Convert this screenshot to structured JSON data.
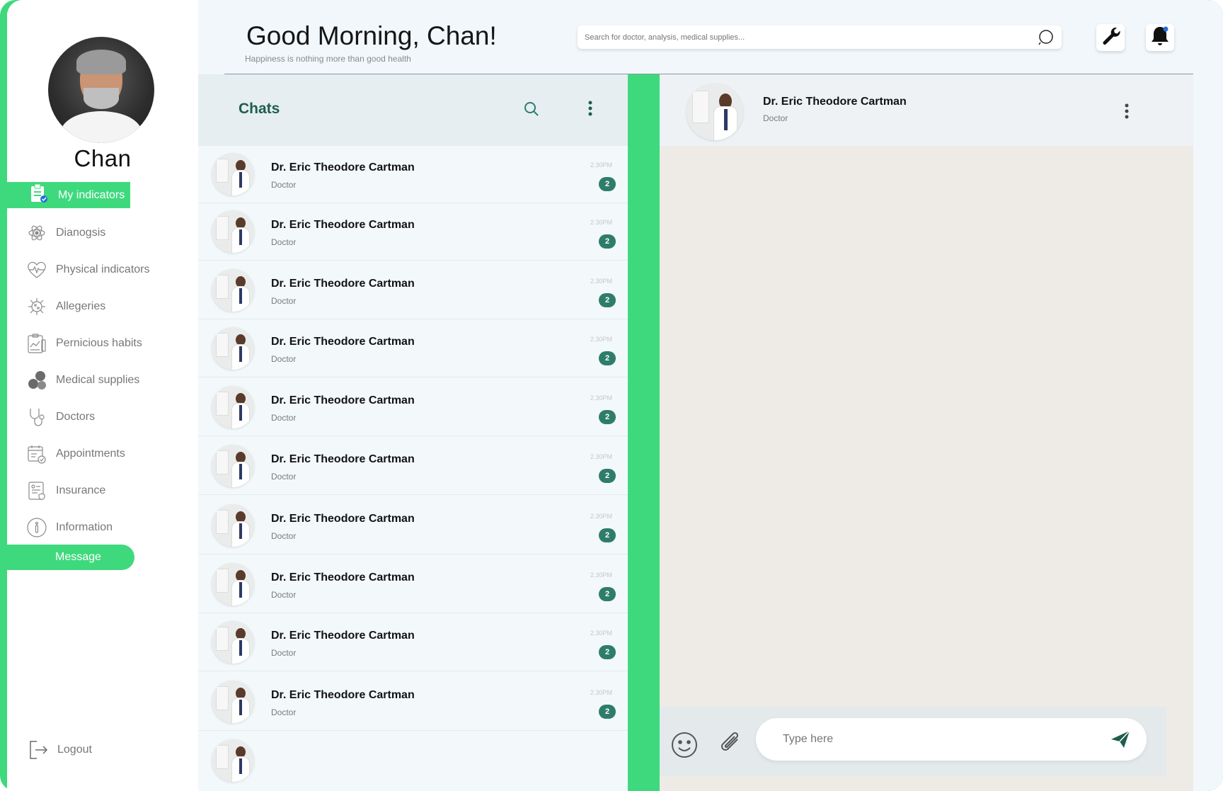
{
  "user": {
    "name": "Chan"
  },
  "header": {
    "greeting": "Good Morning, Chan!",
    "tagline": "Happiness is nothing more than good health",
    "search_placeholder": "Search for doctor, analysis, medical supplies..."
  },
  "sidebar": {
    "active_item": "My indicators",
    "items": [
      {
        "label": "Dianogsis",
        "icon": "atom-icon"
      },
      {
        "label": "Physical indicators",
        "icon": "heart-pulse-icon"
      },
      {
        "label": "Allegeries",
        "icon": "virus-icon"
      },
      {
        "label": "Pernicious habits",
        "icon": "clipboard-chart-icon"
      },
      {
        "label": "Medical supplies",
        "icon": "pills-icon"
      },
      {
        "label": "Doctors",
        "icon": "stethoscope-icon"
      },
      {
        "label": "Appointments",
        "icon": "calendar-check-icon"
      },
      {
        "label": "Insurance",
        "icon": "insurance-doc-icon"
      },
      {
        "label": "Information",
        "icon": "info-icon"
      }
    ],
    "message": "Message",
    "logout": "Logout"
  },
  "chats": {
    "title": "Chats",
    "list": [
      {
        "name": "Dr. Eric Theodore Cartman",
        "role": "Doctor",
        "time": "2.30PM",
        "unread": "2"
      },
      {
        "name": "Dr. Eric Theodore Cartman",
        "role": "Doctor",
        "time": "2.30PM",
        "unread": "2"
      },
      {
        "name": "Dr. Eric Theodore Cartman",
        "role": "Doctor",
        "time": "2.30PM",
        "unread": "2"
      },
      {
        "name": "Dr. Eric Theodore Cartman",
        "role": "Doctor",
        "time": "2.30PM",
        "unread": "2"
      },
      {
        "name": "Dr. Eric Theodore Cartman",
        "role": "Doctor",
        "time": "2.30PM",
        "unread": "2"
      },
      {
        "name": "Dr. Eric Theodore Cartman",
        "role": "Doctor",
        "time": "2.30PM",
        "unread": "2"
      },
      {
        "name": "Dr. Eric Theodore Cartman",
        "role": "Doctor",
        "time": "2.30PM",
        "unread": "2"
      },
      {
        "name": "Dr. Eric Theodore Cartman",
        "role": "Doctor",
        "time": "2.30PM",
        "unread": "2"
      },
      {
        "name": "Dr. Eric Theodore Cartman",
        "role": "Doctor",
        "time": "2.30PM",
        "unread": "2"
      },
      {
        "name": "Dr. Eric Theodore Cartman",
        "role": "Doctor",
        "time": "2.30PM",
        "unread": "2"
      }
    ]
  },
  "conversation": {
    "name": "Dr. Eric Theodore Cartman",
    "role": "Doctor",
    "input_placeholder": "Type here"
  },
  "colors": {
    "accent_green": "#3fd97d",
    "badge_green": "#2e7d6a",
    "title_green": "#1f5d4d"
  }
}
